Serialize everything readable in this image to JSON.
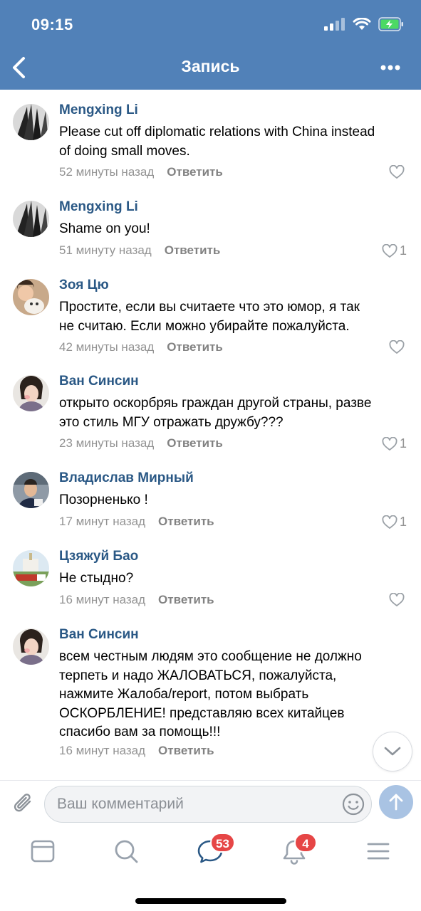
{
  "status_bar": {
    "time": "09:15"
  },
  "header": {
    "title": "Запись"
  },
  "comments": [
    {
      "author": "Mengxing Li",
      "lines": [
        "Please cut off diplomatic relations with China instead",
        "of doing small moves."
      ],
      "time": "52 минуты назад",
      "reply_label": "Ответить",
      "likes": ""
    },
    {
      "author": "Mengxing Li",
      "lines": [
        "Shame on you!"
      ],
      "time": "51 минуту назад",
      "reply_label": "Ответить",
      "likes": "1"
    },
    {
      "author": "Зоя Цю",
      "lines": [
        "Простите,  если вы считаете что это юмор,  я так",
        "не считаю.  Если можно убирайте пожалуйста."
      ],
      "time": "42 минуты назад",
      "reply_label": "Ответить",
      "likes": ""
    },
    {
      "author": "Ван Синсин",
      "lines": [
        "открыто оскорбряь граждан другой страны, разве",
        "это стиль МГУ отражать дружбу???"
      ],
      "time": "23 минуты назад",
      "reply_label": "Ответить",
      "likes": "1"
    },
    {
      "author": "Владислав Мирный",
      "lines": [
        "Позорненько !"
      ],
      "time": "17 минут назад",
      "reply_label": "Ответить",
      "likes": "1"
    },
    {
      "author": "Цзяжуй Бао",
      "lines": [
        "Не стыдно?"
      ],
      "time": "16 минут назад",
      "reply_label": "Ответить",
      "likes": ""
    },
    {
      "author": "Ван Синсин",
      "lines": [
        "всем честным людям это сообщение не должно",
        "терпеть и надо ЖАЛОВАТЬСЯ, пожалуйста,",
        "нажмите Жалоба/report,  потом выбрать",
        "ОСКОРБЛЕНИЕ!  представляю всех китайцев",
        "спасибо вам за помощь!!!"
      ],
      "time": "16 минут назад",
      "reply_label": "Ответить",
      "likes": ""
    }
  ],
  "composer": {
    "placeholder": "Ваш комментарий"
  },
  "tabbar": {
    "messages_badge": "53",
    "notifications_badge": "4"
  },
  "colors": {
    "header_bg": "#5181b8",
    "author": "#2a5885",
    "badge": "#e64646",
    "send_button": "#a9c3e3"
  },
  "icons": [
    "back-icon",
    "more-icon",
    "heart-icon",
    "chevron-down-icon",
    "paperclip-icon",
    "emoji-icon",
    "arrow-up-icon",
    "news-icon",
    "search-icon",
    "messages-icon",
    "bell-icon",
    "menu-icon"
  ]
}
